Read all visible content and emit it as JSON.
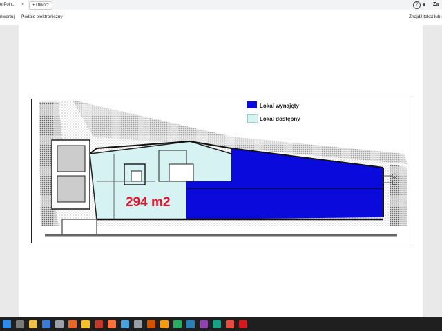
{
  "browser": {
    "tab_title": "erPoin...",
    "tab_close": "×",
    "new_tab_label": "+ Utwórz",
    "account_label": "Za"
  },
  "toolbar": {
    "convert_label": "nwertuj",
    "e_signature_label": "Podpis elektroniczny",
    "find_label": "Znajdź tekst lub n"
  },
  "document": {
    "legend": [
      {
        "label": "Lokal wynajęty",
        "color": "#0a0adc"
      },
      {
        "label": "Lokal dostępny",
        "color": "#d7f2f2"
      }
    ],
    "area_label": "294 m2",
    "area_label_color": "#e0142b"
  },
  "taskbar": {
    "icons": [
      {
        "name": "start-icon",
        "color": "#2e8bea"
      },
      {
        "name": "search-icon",
        "color": "#7a7a7a"
      },
      {
        "name": "folder-icon",
        "color": "#f2c34a"
      },
      {
        "name": "store-icon",
        "color": "#3b7bd6"
      },
      {
        "name": "app-icon",
        "color": "#9aa0a6"
      },
      {
        "name": "firefox-icon",
        "color": "#e8662a"
      },
      {
        "name": "chrome-icon",
        "color": "#f6c026"
      },
      {
        "name": "app2-icon",
        "color": "#c0392b"
      },
      {
        "name": "firefox2-icon",
        "color": "#ff7139"
      },
      {
        "name": "app3-icon",
        "color": "#4aa3df"
      },
      {
        "name": "app4-icon",
        "color": "#9aa0a6"
      },
      {
        "name": "app5-icon",
        "color": "#d35400"
      },
      {
        "name": "vlc-icon",
        "color": "#f39c12"
      },
      {
        "name": "app6-icon",
        "color": "#27ae60"
      },
      {
        "name": "app7-icon",
        "color": "#2980b9"
      },
      {
        "name": "app8-icon",
        "color": "#8e44ad"
      },
      {
        "name": "app9-icon",
        "color": "#16a085"
      },
      {
        "name": "app10-icon",
        "color": "#e74c3c"
      },
      {
        "name": "pdf-icon",
        "color": "#d71920"
      }
    ]
  }
}
